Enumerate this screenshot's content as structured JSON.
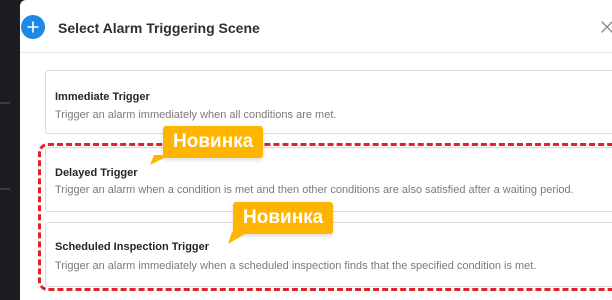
{
  "dialog": {
    "title": "Select Alarm Triggering Scene",
    "add_icon": "plus-icon",
    "close_icon": "close-icon"
  },
  "options": [
    {
      "title": "Immediate Trigger",
      "description": "Trigger an alarm immediately when all conditions are met."
    },
    {
      "title": "Delayed Trigger",
      "description": "Trigger an alarm when a condition is met and then other conditions are also satisfied after a waiting period."
    },
    {
      "title": "Scheduled Inspection Trigger",
      "description": "Trigger an alarm immediately when a scheduled inspection finds that the specified condition is met."
    }
  ],
  "badges": [
    "Новинка",
    "Новинка"
  ],
  "colors": {
    "accent": "#1e88e5",
    "highlight": "#e3202a",
    "badge": "#ffb400"
  }
}
